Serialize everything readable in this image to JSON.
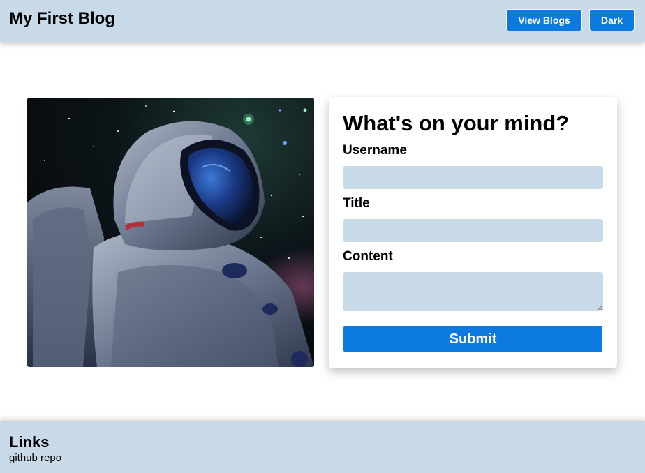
{
  "header": {
    "brand": "My First Blog",
    "view_blogs_label": "View Blogs",
    "theme_toggle_label": "Dark"
  },
  "hero": {
    "image_subject": "astronaut-in-space"
  },
  "form": {
    "title": "What's on your mind?",
    "username_label": "Username",
    "username_value": "",
    "title_label": "Title",
    "title_value": "",
    "content_label": "Content",
    "content_value": "",
    "submit_label": "Submit"
  },
  "footer": {
    "title": "Links",
    "link_label": "github repo"
  },
  "colors": {
    "bar_bg": "#c8d9e8",
    "accent": "#0d7ae0",
    "input_bg": "#c8d9e8"
  }
}
